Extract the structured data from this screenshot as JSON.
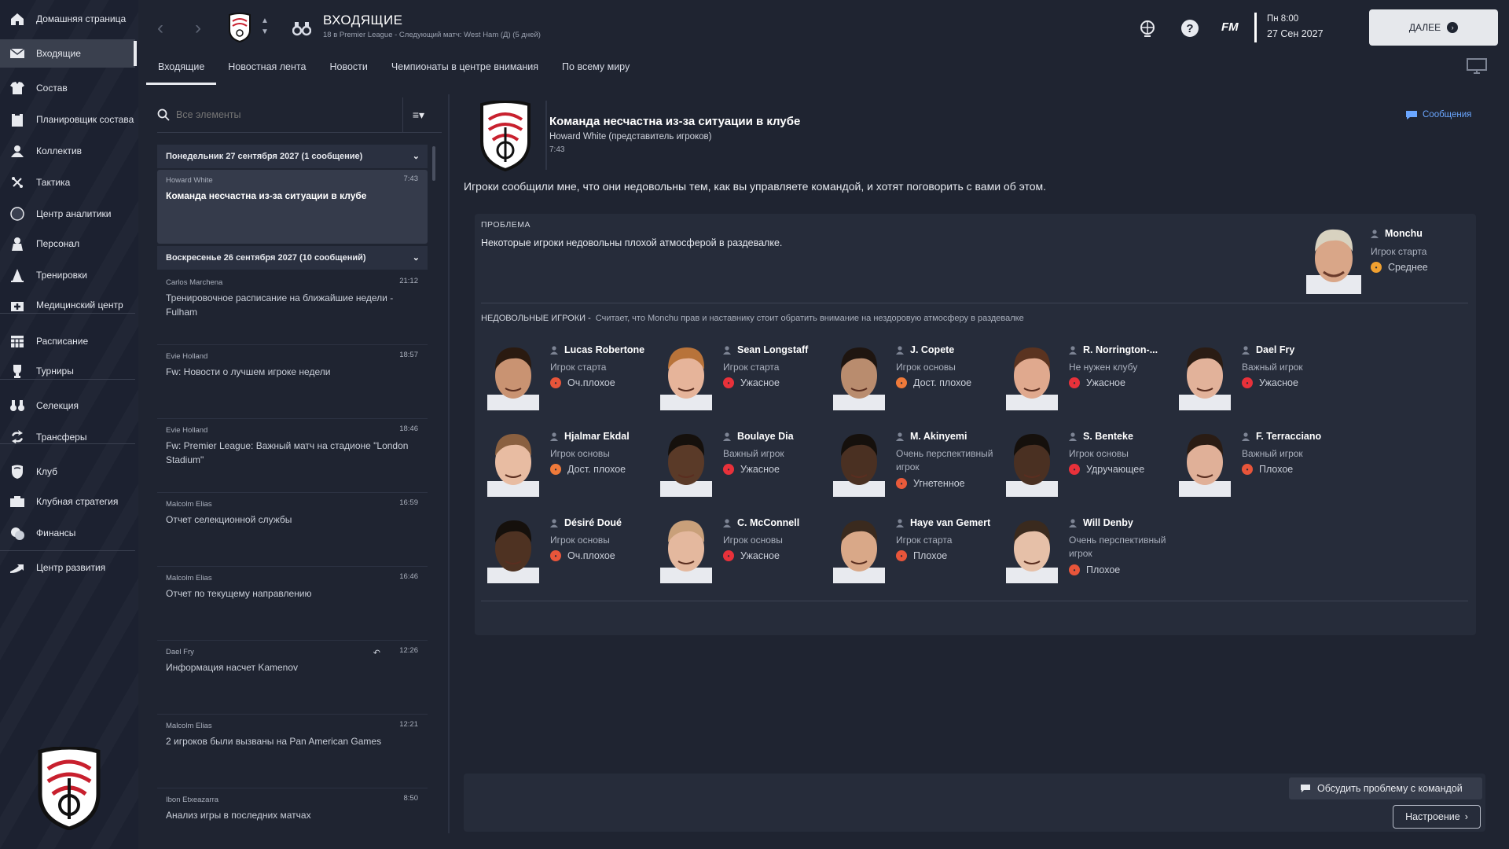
{
  "sidebar": {
    "items": [
      {
        "label": "Домашняя страница",
        "icon": "home-icon"
      },
      {
        "label": "Входящие",
        "icon": "envelope-icon",
        "active": true
      },
      {
        "label": "Состав",
        "icon": "shirt-icon"
      },
      {
        "label": "Планировщик состава",
        "icon": "clipboard-icon"
      },
      {
        "label": "Коллектив",
        "icon": "team-icon"
      },
      {
        "label": "Тактика",
        "icon": "tactics-icon"
      },
      {
        "label": "Центр аналитики",
        "icon": "analytics-icon"
      },
      {
        "label": "Персонал",
        "icon": "staff-icon"
      },
      {
        "label": "Тренировки",
        "icon": "cone-icon"
      },
      {
        "label": "Медицинский центр",
        "icon": "medical-icon"
      },
      {
        "label": "Расписание",
        "icon": "calendar-icon"
      },
      {
        "label": "Турниры",
        "icon": "trophy-icon"
      },
      {
        "label": "Селекция",
        "icon": "binoculars-icon"
      },
      {
        "label": "Трансферы",
        "icon": "transfer-icon"
      },
      {
        "label": "Клуб",
        "icon": "shield-icon"
      },
      {
        "label": "Клубная стратегия",
        "icon": "strategy-icon"
      },
      {
        "label": "Финансы",
        "icon": "finance-icon"
      },
      {
        "label": "Центр развития",
        "icon": "development-icon"
      }
    ]
  },
  "header": {
    "title": "ВХОДЯЩИЕ",
    "subtitle": "18 в Premier League - Следующий матч: West Ham (Д) (5 дней)",
    "tabs": [
      "Входящие",
      "Новостная лента",
      "Новости",
      "Чемпионаты в центре внимания",
      "По всему миру"
    ],
    "fm_logo": "FM",
    "day_time": "Пн 8:00",
    "date": "27 Сен 2027",
    "next_label": "ДАЛЕЕ"
  },
  "list": {
    "search_placeholder": "Все элементы",
    "groups": [
      {
        "label": "Понедельник 27 сентября 2027 (1 сообщение)"
      },
      {
        "label": "Воскресенье 26 сентября 2027 (10 сообщений)"
      }
    ],
    "messages": [
      {
        "from": "Howard White",
        "time": "7:43",
        "subject": "Команда несчастна из-за ситуации в клубе"
      },
      {
        "from": "Carlos Marchena",
        "time": "21:12",
        "subject": "Тренировочное расписание на ближайшие недели - Fulham"
      },
      {
        "from": "Evie Holland",
        "time": "18:57",
        "subject": "Fw: Новости о лучшем игроке недели"
      },
      {
        "from": "Evie Holland",
        "time": "18:46",
        "subject": "Fw: Premier League: Важный матч на стадионе \"London Stadium\""
      },
      {
        "from": "Malcolm Elias",
        "time": "16:59",
        "subject": "Отчет селекционной службы"
      },
      {
        "from": "Malcolm Elias",
        "time": "16:46",
        "subject": "Отчет по текущему направлению"
      },
      {
        "from": "Dael Fry",
        "time": "12:26",
        "subject": "Информация насчет Kamenov"
      },
      {
        "from": "Malcolm Elias",
        "time": "12:21",
        "subject": "2 игроков были вызваны на Pan American Games"
      },
      {
        "from": "Ibon Etxeazarra",
        "time": "8:50",
        "subject": "Анализ игры в последних матчах"
      }
    ]
  },
  "detail": {
    "title": "Команда несчастна из-за ситуации в клубе",
    "from": "Howard White  (представитель игроков)",
    "time": "7:43",
    "messages_link": "Сообщения",
    "body": "Игроки сообщили мне, что они недовольны тем, как вы управляете командой, и хотят поговорить с вами об этом.",
    "problem_label": "ПРОБЛЕМА",
    "problem_text": "Некоторые игроки недовольны плохой атмосферой в раздевалке.",
    "leader": {
      "name": "Monchu",
      "role": "Игрок старта",
      "mood": "Среднее",
      "mood_color": "#f0a030"
    },
    "unhappy_label": "НЕДОВОЛЬНЫЕ ИГРОКИ -",
    "unhappy_quote": "Считает, что Monchu прав и наставнику стоит обратить внимание на нездоровую атмосферу в раздевалке",
    "players": [
      {
        "name": "Lucas Robertone",
        "role": "Игрок старта",
        "mood": "Оч.плохое",
        "color": "#e8553a",
        "skin": "#c99372",
        "hair": "#2a1a10"
      },
      {
        "name": "Sean Longstaff",
        "role": "Игрок старта",
        "mood": "Ужасное",
        "color": "#e8313a",
        "skin": "#e6b49a",
        "hair": "#b8733a"
      },
      {
        "name": "J. Copete",
        "role": "Игрок основы",
        "mood": "Дост. плохое",
        "color": "#ef7a3a",
        "skin": "#b98c6e",
        "hair": "#1e1510"
      },
      {
        "name": "R. Norrington-...",
        "role": "Не нужен клубу",
        "mood": "Ужасное",
        "color": "#e8313a",
        "skin": "#e0a98e",
        "hair": "#5a3320"
      },
      {
        "name": "Dael Fry",
        "role": "Важный игрок",
        "mood": "Ужасное",
        "color": "#e8313a",
        "skin": "#e2b29a",
        "hair": "#2a1c14"
      },
      {
        "name": "Hjalmar Ekdal",
        "role": "Игрок основы",
        "mood": "Дост. плохое",
        "color": "#ef7a3a",
        "skin": "#e8bca2",
        "hair": "#8a6040"
      },
      {
        "name": "Boulaye Dia",
        "role": "Важный игрок",
        "mood": "Ужасное",
        "color": "#e8313a",
        "skin": "#5a3a28",
        "hair": "#15100c"
      },
      {
        "name": "M. Akinyemi",
        "role": "Очень перспективный игрок",
        "mood": "Угнетенное",
        "color": "#e85a3a",
        "skin": "#4a3022",
        "hair": "#15100c"
      },
      {
        "name": "S. Benteke",
        "role": "Игрок основы",
        "mood": "Удручающее",
        "color": "#e8313a",
        "skin": "#4a3022",
        "hair": "#15100c"
      },
      {
        "name": "F. Terracciano",
        "role": "Важный игрок",
        "mood": "Плохое",
        "color": "#e8553a",
        "skin": "#e0b098",
        "hair": "#2a1c14"
      },
      {
        "name": "Désiré Doué",
        "role": "Игрок основы",
        "mood": "Оч.плохое",
        "color": "#e8553a",
        "skin": "#4e3222",
        "hair": "#15100c"
      },
      {
        "name": "C. McConnell",
        "role": "Игрок основы",
        "mood": "Ужасное",
        "color": "#e8313a",
        "skin": "#e4b89e",
        "hair": "#c9a07a"
      },
      {
        "name": "Haye van Gemert",
        "role": "Игрок старта",
        "mood": "Плохое",
        "color": "#e8553a",
        "skin": "#d9a888",
        "hair": "#3a2a1e"
      },
      {
        "name": "Will Denby",
        "role": "Очень перспективный игрок",
        "mood": "Плохое",
        "color": "#e8553a",
        "skin": "#e6c0a8",
        "hair": "#3a2a1e"
      }
    ],
    "discuss_label": "Обсудить проблему с командой",
    "mood_label": "Настроение"
  }
}
